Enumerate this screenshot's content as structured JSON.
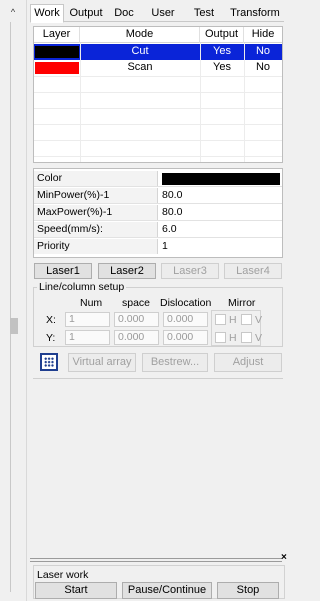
{
  "tabs": [
    "Work",
    "Output",
    "Doc",
    "User",
    "Test",
    "Transform"
  ],
  "active_tab": "Work",
  "layer_table": {
    "headers": [
      "Layer",
      "Mode",
      "Output",
      "Hide"
    ],
    "rows": [
      {
        "color": "#000000",
        "mode": "Cut",
        "output": "Yes",
        "hide": "No",
        "selected": true
      },
      {
        "color": "#ff0000",
        "mode": "Scan",
        "output": "Yes",
        "hide": "No",
        "selected": false
      }
    ]
  },
  "properties": {
    "color_label": "Color",
    "color_value": "#000000",
    "min_power_label": "MinPower(%)-1",
    "min_power_value": "80.0",
    "max_power_label": "MaxPower(%)-1",
    "max_power_value": "80.0",
    "speed_label": "Speed(mm/s):",
    "speed_value": "6.0",
    "priority_label": "Priority",
    "priority_value": "1"
  },
  "laser_buttons": [
    "Laser1",
    "Laser2",
    "Laser3",
    "Laser4"
  ],
  "line_column": {
    "title": "Line/column setup",
    "headers": {
      "num": "Num",
      "space": "space",
      "dislocation": "Dislocation",
      "mirror": "Mirror"
    },
    "x_label": "X:",
    "y_label": "Y:",
    "x": {
      "num": "1",
      "space": "0.000",
      "dislocation": "0.000"
    },
    "y": {
      "num": "1",
      "space": "0.000",
      "dislocation": "0.000"
    },
    "h_label": "H",
    "v_label": "V"
  },
  "array_buttons": {
    "virtual": "Virtual array",
    "bestrew": "Bestrew...",
    "adjust": "Adjust"
  },
  "laser_work": {
    "title": "Laser work",
    "start": "Start",
    "pause": "Pause/Continue",
    "stop": "Stop"
  },
  "close_symbol": "×",
  "up_arrow_symbol": "^",
  "colors": {
    "selection": "#0a24d8",
    "accent": "#1f3e8f"
  }
}
